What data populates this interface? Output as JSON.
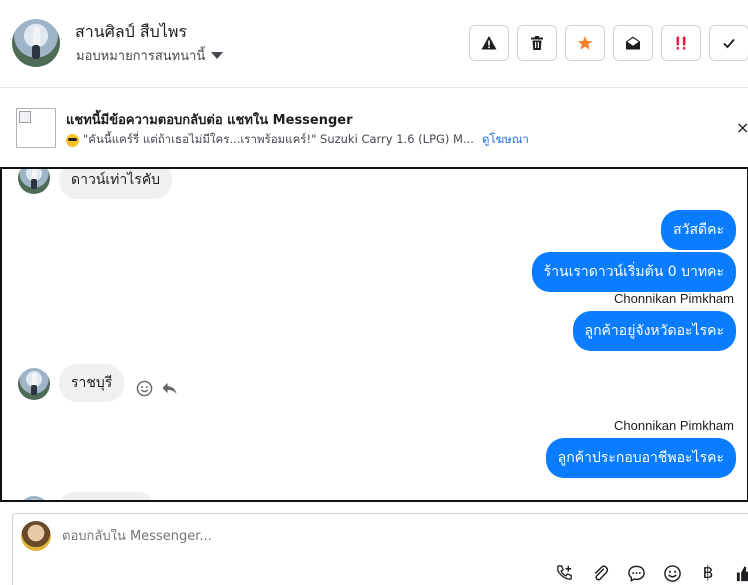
{
  "header": {
    "contact_name": "สานศิลป์ สืบไพร",
    "assign_label": "มอบหมายการสนทนานี้",
    "actions": [
      {
        "icon": "warning-icon",
        "color": "#1c1e21"
      },
      {
        "icon": "trash-icon",
        "color": "#1c1e21"
      },
      {
        "icon": "star-icon",
        "color": "#f5822a"
      },
      {
        "icon": "envelope-open-icon",
        "color": "#1c1e21"
      },
      {
        "icon": "priority-icon",
        "color": "#e41e3f"
      },
      {
        "icon": "check-icon",
        "color": "#1c1e21"
      }
    ]
  },
  "ad": {
    "title": "แชทนี้มีข้อความตอบกลับต่อ แชทใน Messenger",
    "snippet": "\"คันนี้แคร์รี่ แต่ถ้าเธอไม่มีใคร...เราพร้อมแคร์!\" Suzuki Carry 1.6 (LPG) M...",
    "link": "ดูโฆษณา",
    "close": "×"
  },
  "messages": {
    "m1": "ดาวน์เท่าไรคับ",
    "m2": "สวัสดีคะ",
    "m3": "ร้านเราดาวน์เริ่มต้น 0 บาทคะ",
    "sender1": "Chonnikan Pimkham",
    "m4": "ลูกค้าอยู่จังหวัดอะไรคะ",
    "m5": "ราชบุรี",
    "sender2": "Chonnikan Pimkham",
    "m6": "ลูกค้าประกอบอาชีพอะไรคะ"
  },
  "composer": {
    "placeholder": "ตอบกลับใน Messenger...",
    "tools": [
      "call-add-icon",
      "attachment-icon",
      "chat-bubble-icon",
      "emoji-icon",
      "baht-icon",
      "thumbs-up-icon"
    ],
    "baht_symbol": "฿"
  },
  "colors": {
    "accent": "#0a7cff",
    "incoming_bubble": "#f0f0f0",
    "link": "#216fdb"
  }
}
